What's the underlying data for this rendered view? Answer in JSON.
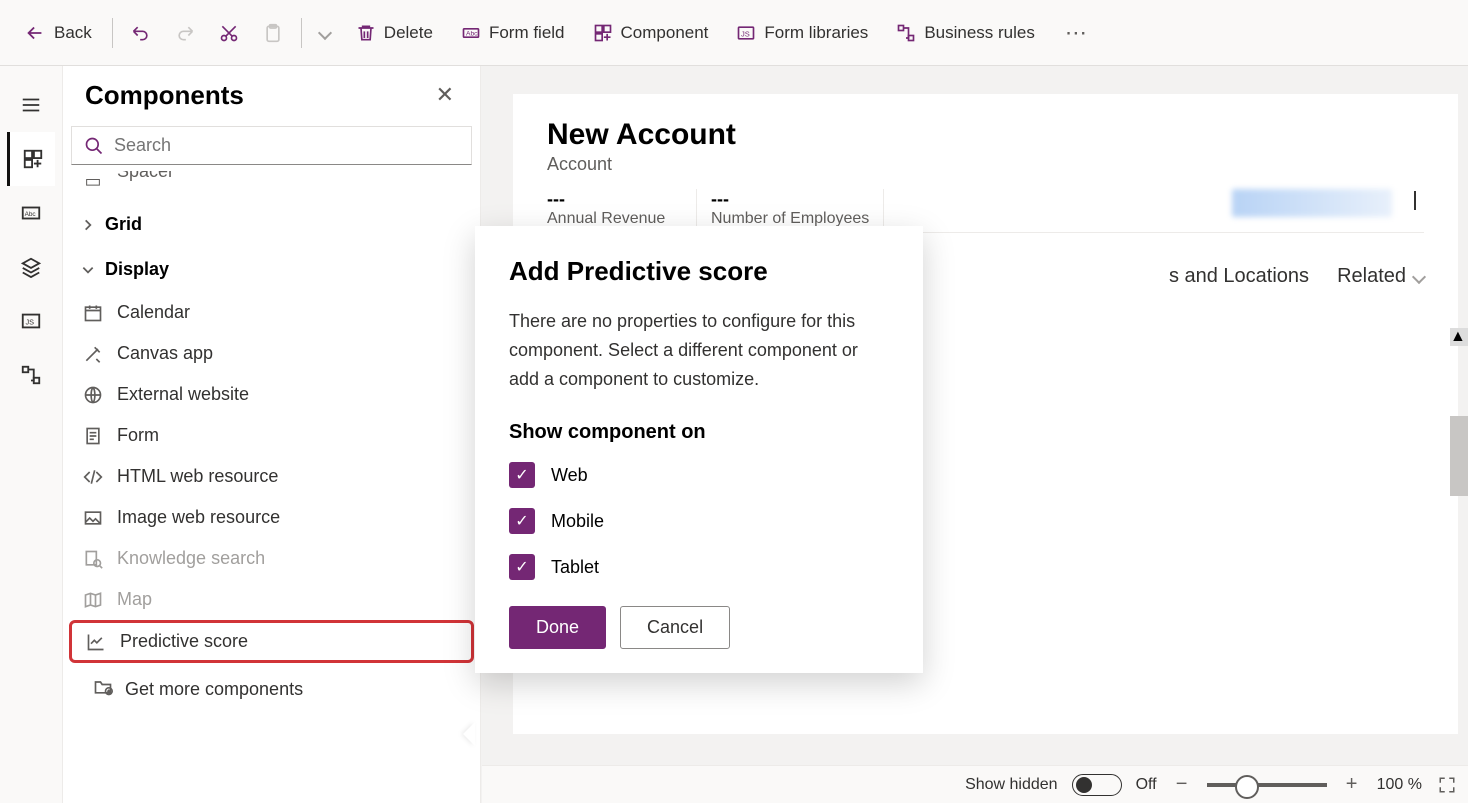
{
  "toolbar": {
    "back": "Back",
    "delete": "Delete",
    "form_field": "Form field",
    "component": "Component",
    "form_libraries": "Form libraries",
    "business_rules": "Business rules"
  },
  "panel": {
    "title": "Components",
    "search_placeholder": "Search",
    "spacer": "Spacer",
    "grid": "Grid",
    "display": "Display",
    "items": {
      "calendar": "Calendar",
      "canvas_app": "Canvas app",
      "external_website": "External website",
      "form": "Form",
      "html_web_resource": "HTML web resource",
      "image_web_resource": "Image web resource",
      "knowledge_search": "Knowledge search",
      "map": "Map",
      "predictive_score": "Predictive score"
    },
    "get_more": "Get more components"
  },
  "form": {
    "title": "New Account",
    "subtitle": "Account",
    "stat1": {
      "value": "---",
      "label": "Annual Revenue"
    },
    "stat2": {
      "value": "---",
      "label": "Number of Employees"
    },
    "tabs": {
      "addresses": "s and Locations",
      "related": "Related"
    }
  },
  "popup": {
    "title": "Add Predictive score",
    "body": "There are no properties to configure for this component. Select a different component or add a component to customize.",
    "show_on": "Show component on",
    "web": "Web",
    "mobile": "Mobile",
    "tablet": "Tablet",
    "done": "Done",
    "cancel": "Cancel"
  },
  "footer": {
    "show_hidden": "Show hidden",
    "off": "Off",
    "zoom": "100 %"
  }
}
